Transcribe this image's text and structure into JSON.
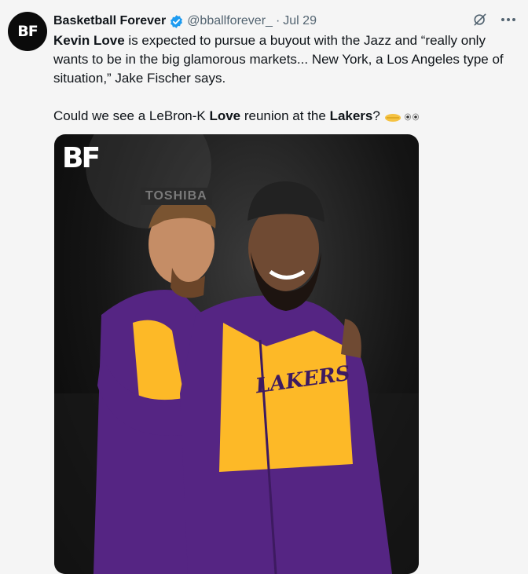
{
  "account": {
    "avatar_text": "BF",
    "name": "Basketball Forever",
    "handle": "@bballforever_",
    "separator": "·",
    "date": "Jul 29"
  },
  "icons": {
    "verified": "verified-badge-icon",
    "grok": "grok-icon",
    "more": "more-icon"
  },
  "tweet": {
    "p1_bold": "Kevin Love",
    "p1_rest": " is expected to pursue a buyout with the Jazz and “really only wants to be in the big glamorous markets... New York, a Los Angeles type of situation,” Jake Fischer says.",
    "p2_a": "Could we see a LeBron-K ",
    "p2_bold1": "Love",
    "p2_b": " reunion at the ",
    "p2_bold2": "Lakers",
    "p2_c": "?"
  },
  "media": {
    "logo_text": "BF",
    "sponsor_text": "TOSHIBA",
    "jersey_text": "LAKERS"
  },
  "colors": {
    "verified": "#1d9bf0",
    "jersey_purple": "#552583",
    "jersey_gold": "#fdb927",
    "text_secondary": "#536471"
  }
}
